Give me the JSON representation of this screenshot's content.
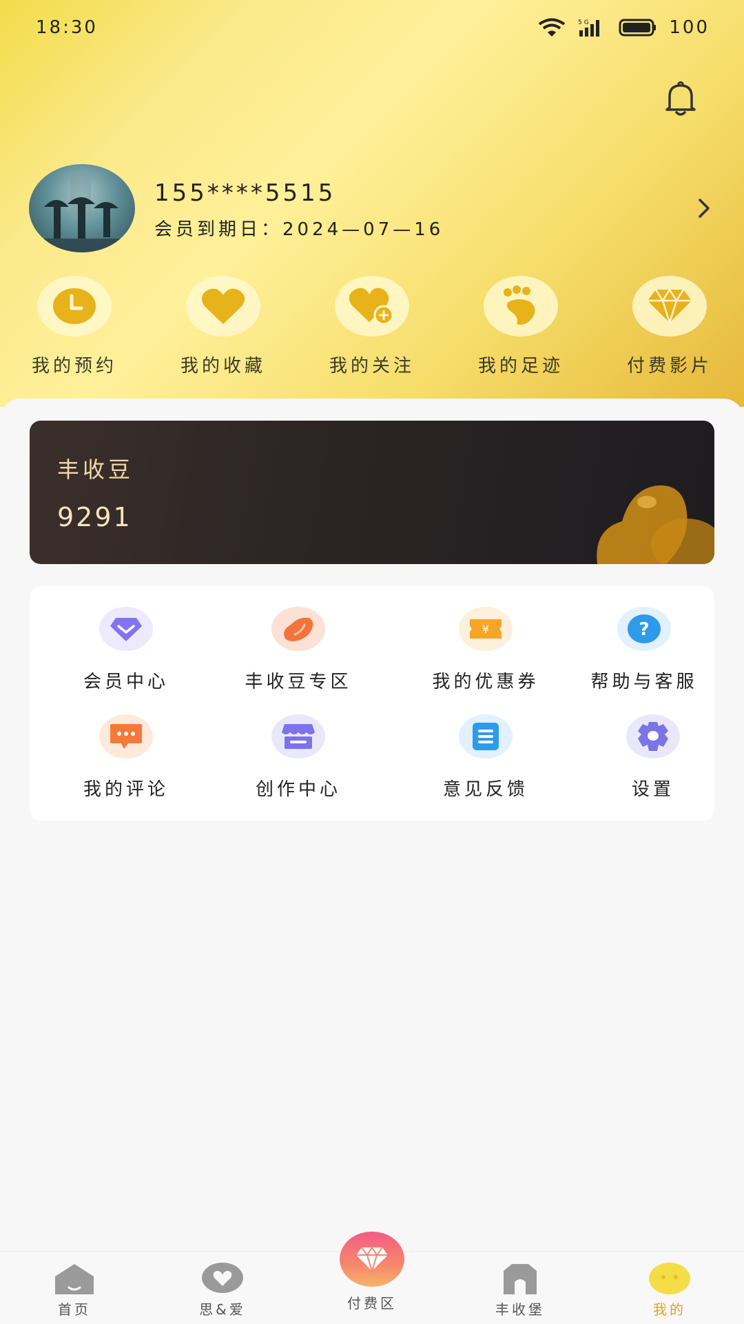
{
  "status_bar": {
    "time": "18:30",
    "battery": "100",
    "network": "5G"
  },
  "profile": {
    "phone": "155****5515",
    "expiry": "会员到期日：2024—07—16"
  },
  "quick_actions": [
    {
      "label": "我的预约",
      "icon": "clock-icon"
    },
    {
      "label": "我的收藏",
      "icon": "heart-icon"
    },
    {
      "label": "我的关注",
      "icon": "heart-plus-icon"
    },
    {
      "label": "我的足迹",
      "icon": "footprint-icon"
    },
    {
      "label": "付费影片",
      "icon": "diamond-icon"
    }
  ],
  "bean_card": {
    "title": "丰收豆",
    "value": "9291"
  },
  "menu": [
    {
      "label": "会员中心",
      "icon": "vip-icon"
    },
    {
      "label": "丰收豆专区",
      "icon": "bean-icon"
    },
    {
      "label": "我的优惠券",
      "icon": "coupon-icon"
    },
    {
      "label": "帮助与客服",
      "icon": "help-icon"
    },
    {
      "label": "我的评论",
      "icon": "comment-icon"
    },
    {
      "label": "创作中心",
      "icon": "store-icon"
    },
    {
      "label": "意见反馈",
      "icon": "feedback-icon"
    },
    {
      "label": "设置",
      "icon": "settings-icon"
    }
  ],
  "tabbar": {
    "items": [
      {
        "label": "首页",
        "icon": "home-icon"
      },
      {
        "label": "思&爱",
        "icon": "chat-heart-icon"
      },
      {
        "label": "付费区",
        "icon": "diamond-icon"
      },
      {
        "label": "丰收堡",
        "icon": "castle-icon"
      },
      {
        "label": "我的",
        "icon": "profile-face-icon"
      }
    ],
    "active_index": 4,
    "accent": "#d9a71f"
  },
  "colors": {
    "hero_yellow": "#f6dd6a",
    "quick_icon": "#e8b21a",
    "card_dark": "#2b2424",
    "bean_text": "#f3d9a9"
  }
}
